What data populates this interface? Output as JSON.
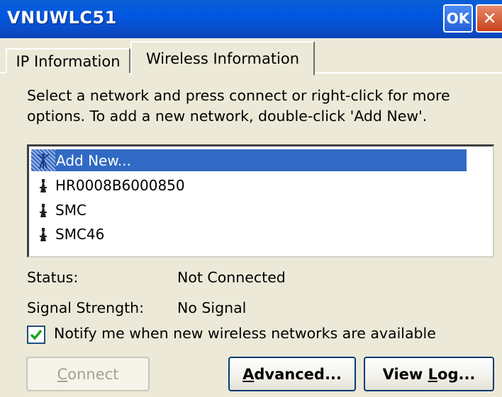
{
  "window": {
    "title": "VNUWLC51",
    "ok_label": "OK",
    "close_label": "✕"
  },
  "tabs": [
    {
      "label": "IP Information",
      "active": false
    },
    {
      "label": "Wireless Information",
      "active": true
    }
  ],
  "instructions": "Select a network and press connect or right-click for more\noptions.  To add a new network, double-click 'Add New'.",
  "networks": [
    {
      "name": "Add New...",
      "icon": "antenna-icon",
      "selected": true
    },
    {
      "name": "HR0008B6000850",
      "icon": "access-point-icon",
      "selected": false
    },
    {
      "name": "SMC",
      "icon": "access-point-icon",
      "selected": false
    },
    {
      "name": "SMC46",
      "icon": "access-point-icon",
      "selected": false
    }
  ],
  "status": {
    "label": "Status:",
    "value": "Not Connected"
  },
  "signal": {
    "label": "Signal Strength:",
    "value": "No Signal"
  },
  "notify": {
    "label": "Notify me when new wireless networks are available",
    "checked": true
  },
  "buttons": {
    "connect": {
      "label_mnemonic": "C",
      "label_rest": "onnect",
      "enabled": false
    },
    "advanced": {
      "label_mnemonic": "A",
      "label_rest": "dvanced...",
      "enabled": true
    },
    "view_log_prefix": "View ",
    "view_log_mnemonic": "L",
    "view_log_rest": "og..."
  },
  "colors": {
    "titlebar": "#0058e0",
    "selection": "#316ac5",
    "dialog_bg": "#ece9d8",
    "check": "#21a121"
  }
}
